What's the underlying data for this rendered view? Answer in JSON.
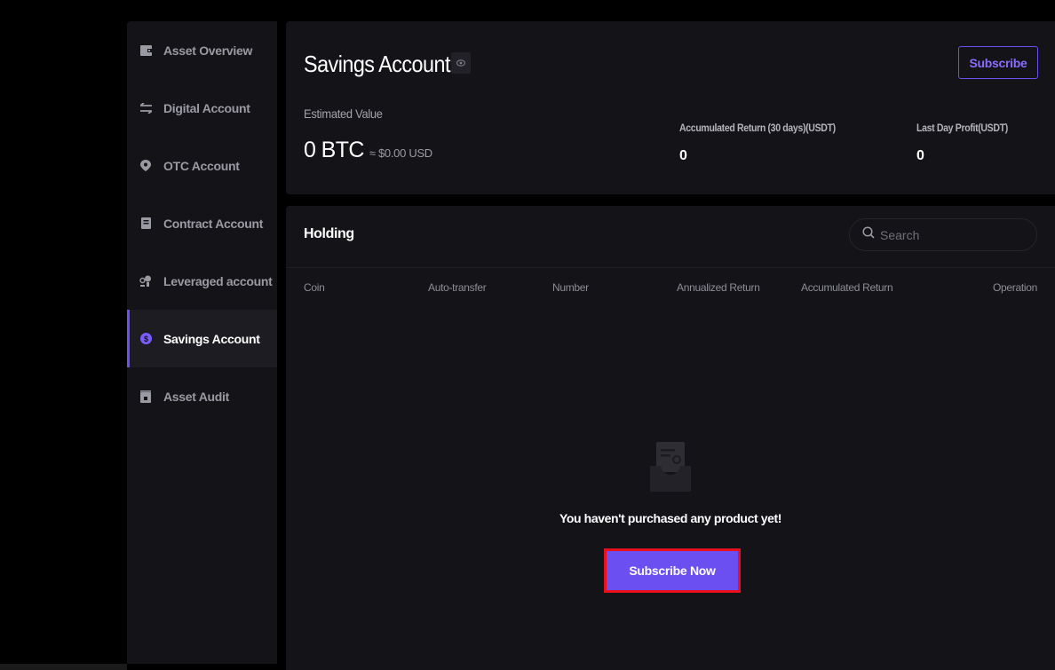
{
  "sidebar": {
    "items": [
      {
        "label": "Asset Overview",
        "icon": "wallet-icon",
        "active": false
      },
      {
        "label": "Digital Account",
        "icon": "transfer-arrows-icon",
        "active": false
      },
      {
        "label": "OTC Account",
        "icon": "location-pin-icon",
        "active": false
      },
      {
        "label": "Contract Account",
        "icon": "document-icon",
        "active": false
      },
      {
        "label": "Leveraged account",
        "icon": "leverage-icon",
        "active": false
      },
      {
        "label": "Savings Account",
        "icon": "dollar-coin-icon",
        "active": true
      },
      {
        "label": "Asset Audit",
        "icon": "audit-icon",
        "active": false
      }
    ]
  },
  "summary": {
    "title": "Savings Account",
    "subscribe_label": "Subscribe",
    "estimated_label": "Estimated Value",
    "estimated_btc": "0 BTC",
    "estimated_usd": "≈ $0.00 USD",
    "accumulated_label": "Accumulated Return (30 days)(USDT)",
    "accumulated_value": "0",
    "lastday_label": "Last Day Profit(USDT)",
    "lastday_value": "0"
  },
  "holding": {
    "title": "Holding",
    "search_placeholder": "Search",
    "columns": [
      "Coin",
      "Auto-transfer",
      "Number",
      "Annualized Return",
      "Accumulated Return",
      "Operation"
    ],
    "empty_text": "You haven't purchased any product yet!",
    "subscribe_now_label": "Subscribe Now"
  },
  "colors": {
    "accent": "#6b4ff0",
    "highlight_border": "#e8101a",
    "panel_bg": "#141318",
    "page_bg": "#000000"
  }
}
